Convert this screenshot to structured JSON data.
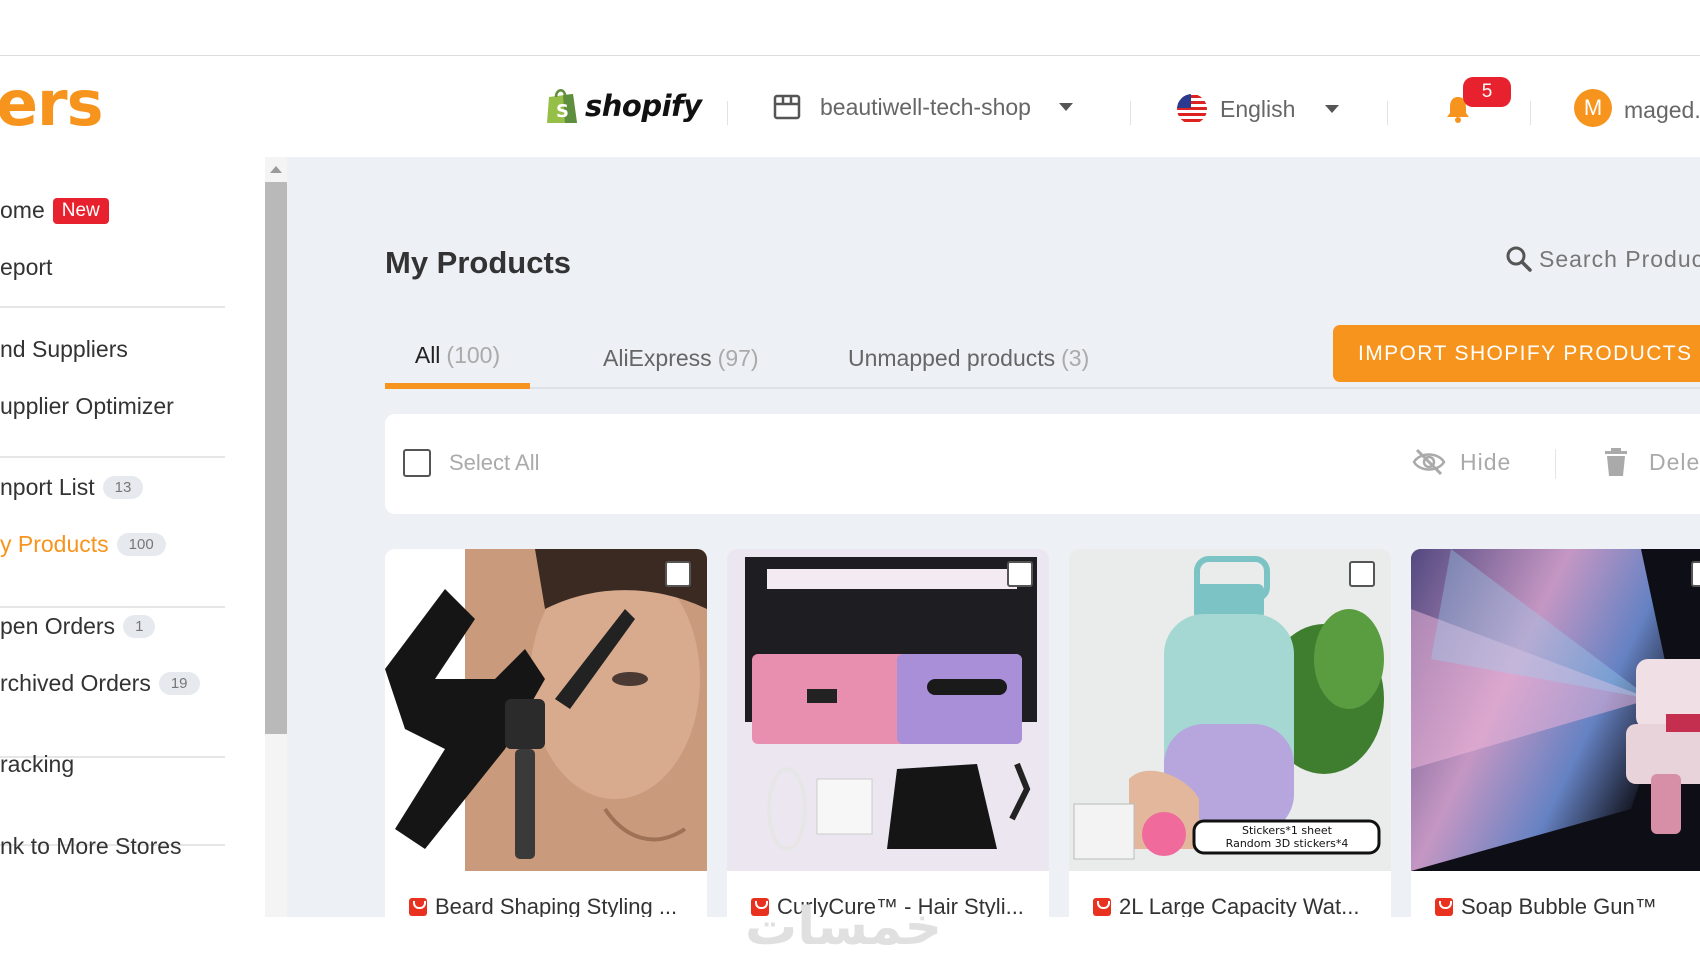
{
  "brand": {
    "logo_text": "ers",
    "accent": "#f7941d"
  },
  "header": {
    "platform": "shopify",
    "store": "beautiwell-tech-shop",
    "language": "English",
    "notifications": "5",
    "avatar_initial": "M",
    "username": "maged."
  },
  "sidebar": {
    "items": [
      {
        "label": "ome",
        "badge": "New"
      },
      {
        "label": "eport"
      },
      {
        "label": "nd Suppliers"
      },
      {
        "label": "upplier Optimizer"
      },
      {
        "label": "nport List",
        "count": "13"
      },
      {
        "label": "y Products",
        "count": "100"
      },
      {
        "label": "pen Orders",
        "count": "1"
      },
      {
        "label": "rchived Orders",
        "count": "19"
      },
      {
        "label": "racking"
      },
      {
        "label": "nk to More Stores"
      }
    ]
  },
  "main": {
    "title": "My Products",
    "search_placeholder": "Search Produc",
    "tabs": [
      {
        "label": "All",
        "count": "(100)"
      },
      {
        "label": "AliExpress",
        "count": "(97)"
      },
      {
        "label": "Unmapped products",
        "count": "(3)"
      }
    ],
    "import_button": "IMPORT SHOPIFY PRODUCTS",
    "toolbar": {
      "select_all": "Select All",
      "hide": "Hide",
      "delete": "Delete"
    },
    "products": [
      {
        "title": "Beard Shaping Styling ..."
      },
      {
        "title": "CurlyCure™ - Hair Styli..."
      },
      {
        "title": "2L Large Capacity Wat..."
      },
      {
        "title": "Soap Bubble Gun™"
      }
    ]
  },
  "watermark": "خمسات"
}
